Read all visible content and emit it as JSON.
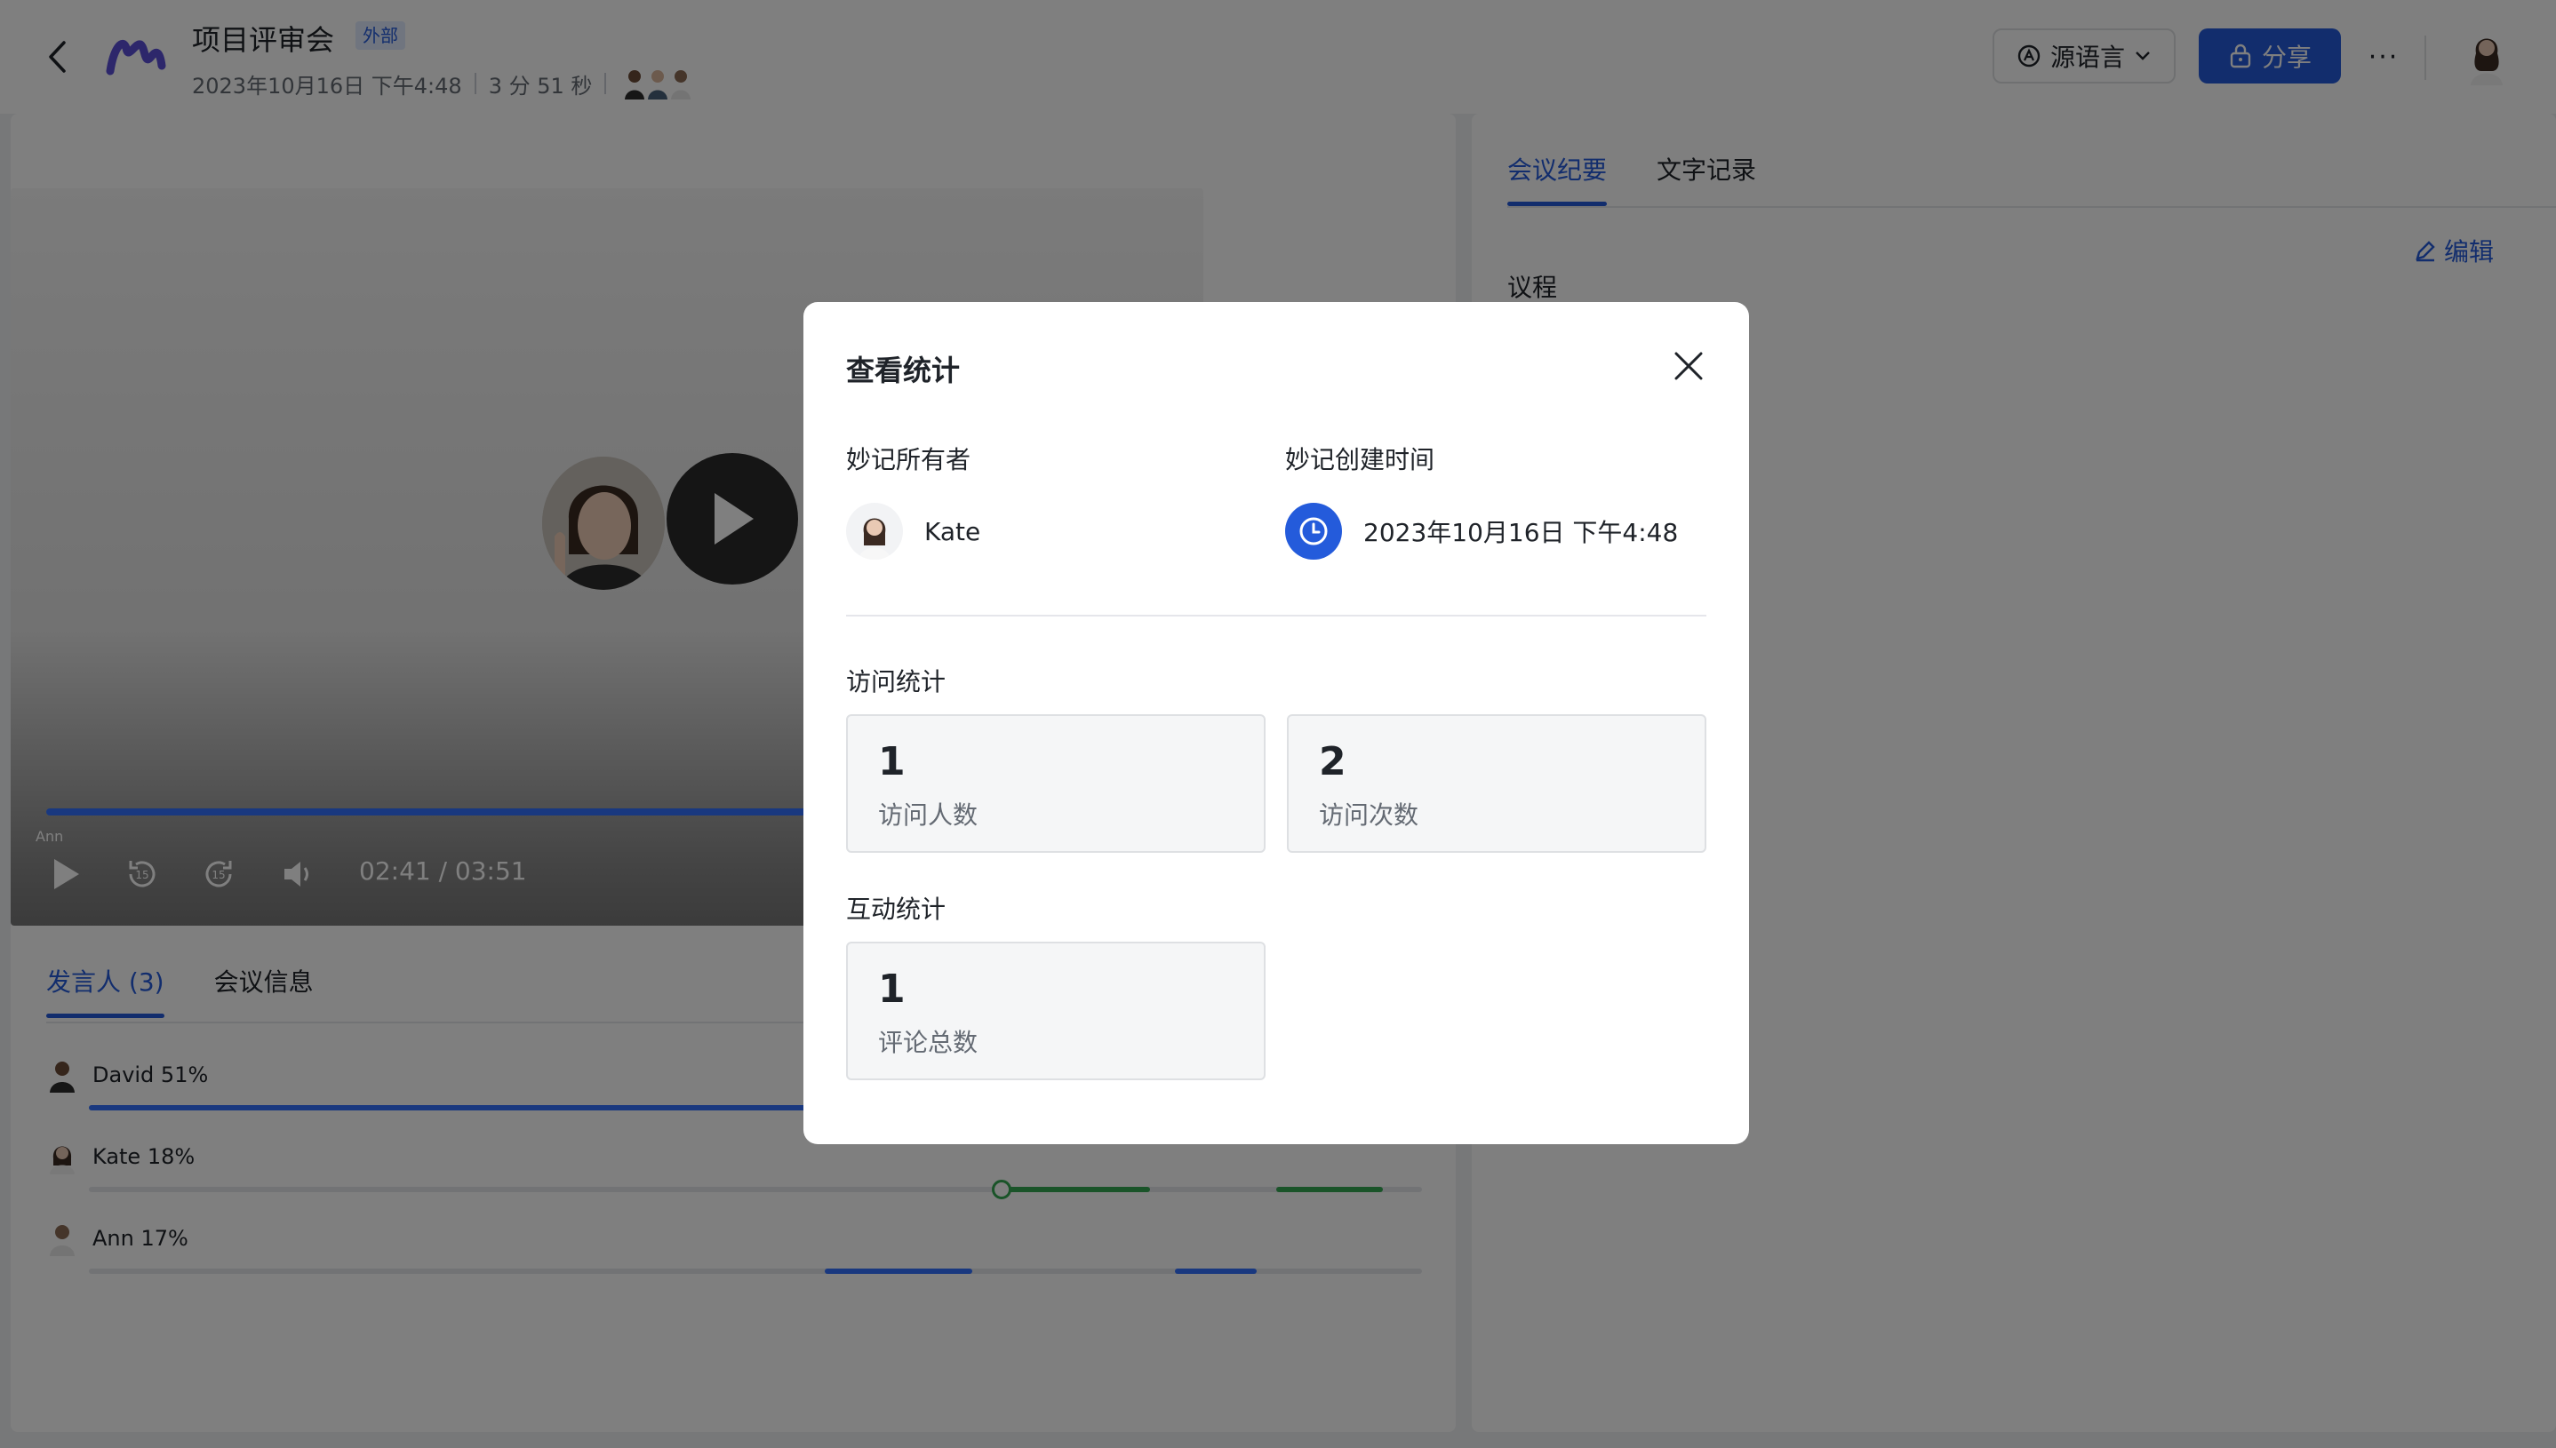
{
  "header": {
    "title": "项目评审会",
    "badge": "外部",
    "date": "2023年10月16日 下午4:48",
    "duration": "3 分 51 秒",
    "lang_label": "源语言",
    "share_label": "分享",
    "more_label": "···"
  },
  "player": {
    "label": "Ann",
    "time": "02:41 / 03:51",
    "rewind_label": "15",
    "forward_label": "15",
    "progress": 0.7
  },
  "left_tabs": [
    "发言人 (3)",
    "会议信息"
  ],
  "speakers": [
    {
      "label": "David 51%",
      "color": "#3370ff"
    },
    {
      "label": "Kate 18%",
      "color": "#34a853"
    },
    {
      "label": "Ann 17%",
      "color": "#3370ff"
    }
  ],
  "right_tabs": [
    "会议纪要",
    "文字记录"
  ],
  "edit_label": "编辑",
  "agenda_label": "议程",
  "modal": {
    "title": "查看统计",
    "owner_label": "妙记所有者",
    "owner_name": "Kate",
    "created_label": "妙记创建时间",
    "created_value": "2023年10月16日 下午4:48",
    "visit_section": "访问统计",
    "visitors_value": "1",
    "visitors_label": "访问人数",
    "visits_value": "2",
    "visits_label": "访问次数",
    "interact_section": "互动统计",
    "comments_value": "1",
    "comments_label": "评论总数"
  },
  "colors": {
    "accent": "#245bdb",
    "overlay": "rgba(0,0,0,0.5)"
  }
}
